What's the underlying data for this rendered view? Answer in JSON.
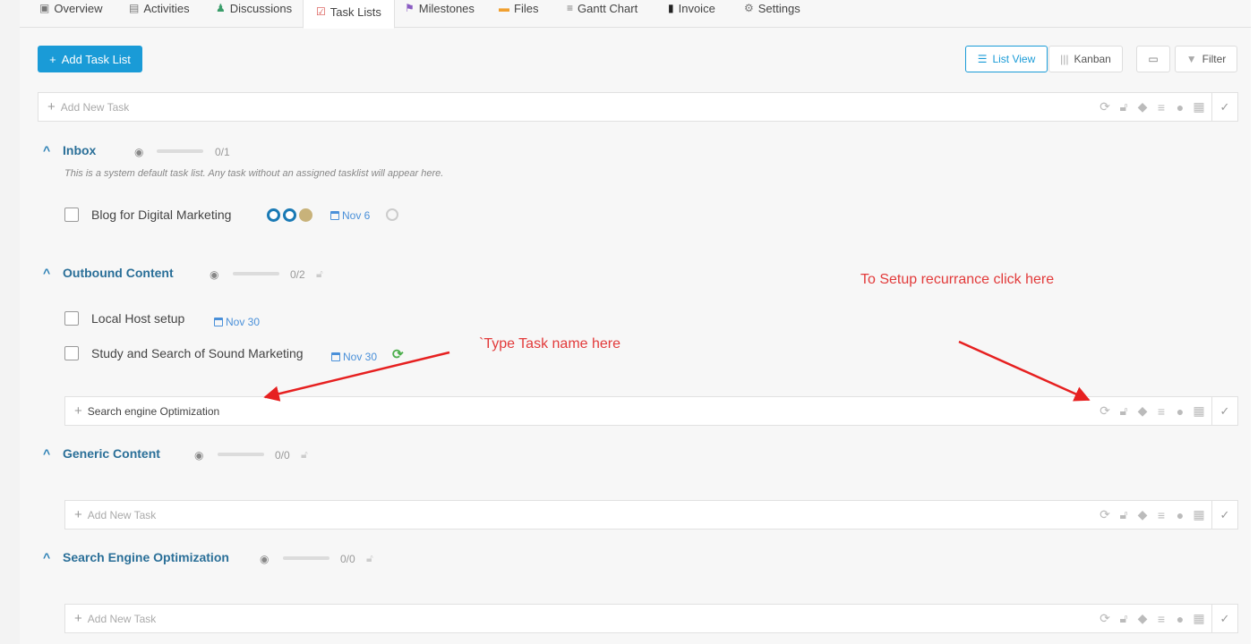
{
  "tabs": [
    {
      "label": "Overview",
      "icon": "monitor-icon"
    },
    {
      "label": "Activities",
      "icon": "activity-icon"
    },
    {
      "label": "Discussions",
      "icon": "people-icon"
    },
    {
      "label": "Task Lists",
      "icon": "checkbox-icon",
      "active": true
    },
    {
      "label": "Milestones",
      "icon": "flag-icon"
    },
    {
      "label": "Files",
      "icon": "folder-icon"
    },
    {
      "label": "Gantt Chart",
      "icon": "gantt-icon"
    },
    {
      "label": "Invoice",
      "icon": "invoice-icon"
    },
    {
      "label": "Settings",
      "icon": "gear-icon"
    }
  ],
  "toolbar": {
    "add_task_list": "Add Task List",
    "list_view": "List View",
    "kanban": "Kanban",
    "filter": "Filter"
  },
  "new_task_placeholder": "Add New Task",
  "lists": [
    {
      "title": "Inbox",
      "count": "0/1",
      "description": "This is a system default task list. Any task without an assigned tasklist will appear here.",
      "tasks": [
        {
          "name": "Blog for Digital Marketing",
          "due": "Nov 6"
        }
      ]
    },
    {
      "title": "Outbound Content",
      "count": "0/2",
      "tasks": [
        {
          "name": "Local Host setup",
          "due": "Nov 30"
        },
        {
          "name": "Study and Search of Sound Marketing",
          "due": "Nov 30"
        }
      ],
      "input_value": "Search engine Optimization"
    },
    {
      "title": "Generic Content",
      "count": "0/0"
    },
    {
      "title": "Search Engine Optimization",
      "count": "0/0"
    }
  ],
  "annotations": {
    "type_task": "`Type Task name here",
    "recurrence": "To Setup recurrance click here"
  },
  "colors": {
    "accent": "#1a9bd7",
    "list_title": "#2a6f98",
    "annotation": "#e23a3a",
    "recurring": "#4cae4c"
  }
}
